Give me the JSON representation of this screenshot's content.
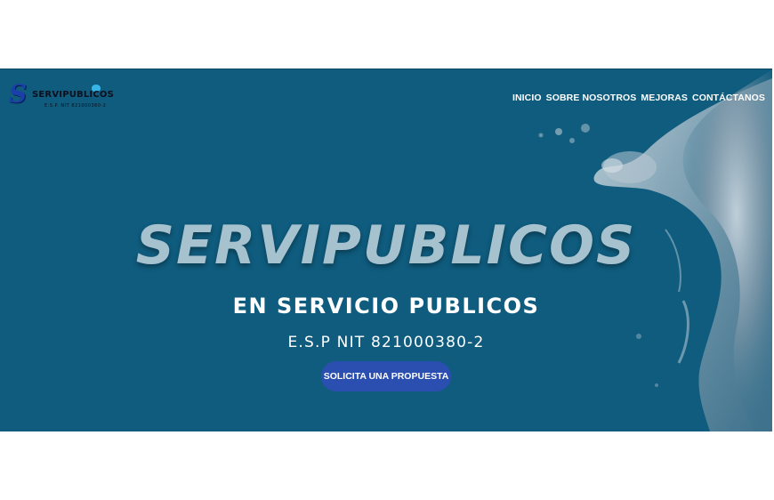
{
  "logo": {
    "letter": "S",
    "name": "SERVIPUBLICOS",
    "tagline": "E.S.P. NIT 821000380-2"
  },
  "nav": {
    "items": [
      "INICIO",
      "SOBRE NOSOTROS",
      "MEJORAS",
      "CONTÁCTANOS"
    ]
  },
  "hero": {
    "title": "SERVIPUBLICOS",
    "subtitle": "EN SERVICIO PUBLICOS",
    "nit": "E.S.P NIT 821000380-2",
    "cta_label": "SOLICITA UNA PROPUESTA"
  },
  "colors": {
    "hero_background": "#0f5c7e",
    "title": "#a7c2cf",
    "cta_background": "#2b4fb0",
    "text": "#ffffff"
  }
}
